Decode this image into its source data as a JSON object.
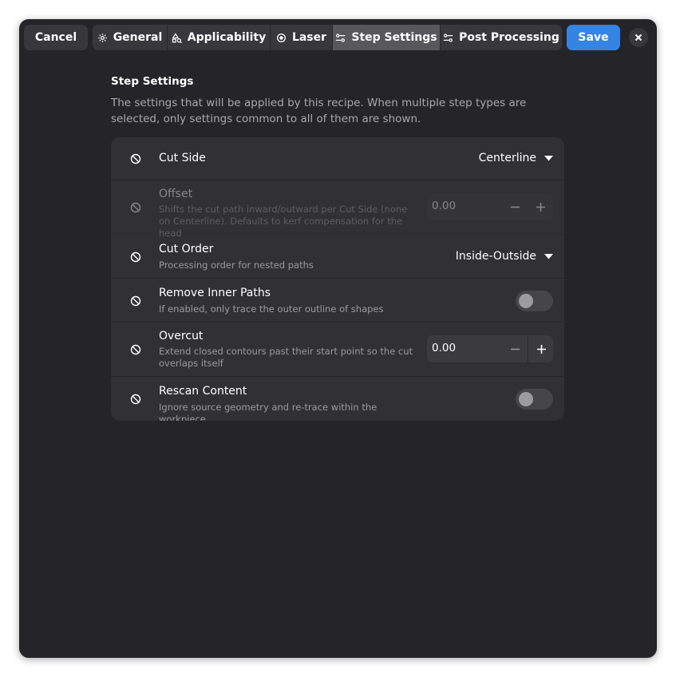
{
  "header": {
    "cancel_label": "Cancel",
    "save_label": "Save",
    "tabs": [
      {
        "label": "General",
        "icon": "gear-icon",
        "active": false
      },
      {
        "label": "Applicability",
        "icon": "shapes-icon",
        "active": false
      },
      {
        "label": "Laser",
        "icon": "target-icon",
        "active": false
      },
      {
        "label": "Step Settings",
        "icon": "sliders-icon",
        "active": true
      },
      {
        "label": "Post Processing",
        "icon": "sliders-icon",
        "active": false
      }
    ]
  },
  "section": {
    "title": "Step Settings",
    "description": "The settings that will be applied by this recipe. When multiple step types are selected, only settings common to all of them are shown."
  },
  "settings": [
    {
      "title": "Cut Side",
      "subtitle": "",
      "control": "dropdown",
      "value": "Centerline",
      "disabled": false
    },
    {
      "title": "Offset",
      "subtitle": "Shifts the cut path inward/outward per Cut Side (none on Centerline). Defaults to kerf compensation for the head",
      "control": "spin",
      "value": "0.00",
      "disabled": true
    },
    {
      "title": "Cut Order",
      "subtitle": "Processing order for nested paths",
      "control": "dropdown",
      "value": "Inside-Outside",
      "disabled": false
    },
    {
      "title": "Remove Inner Paths",
      "subtitle": "If enabled, only trace the outer outline of shapes",
      "control": "switch",
      "value": "off",
      "disabled": false
    },
    {
      "title": "Overcut",
      "subtitle": "Extend closed contours past their start point so the cut overlaps itself",
      "control": "spin",
      "value": "0.00",
      "disabled": false
    },
    {
      "title": "Rescan Content",
      "subtitle": "Ignore source geometry and re-trace within the workpiece",
      "control": "switch",
      "value": "off",
      "disabled": false
    }
  ],
  "colors": {
    "window_bg": "#242429",
    "card_bg": "#303035",
    "accent": "#3584e4",
    "tab_active": "#57575c"
  }
}
